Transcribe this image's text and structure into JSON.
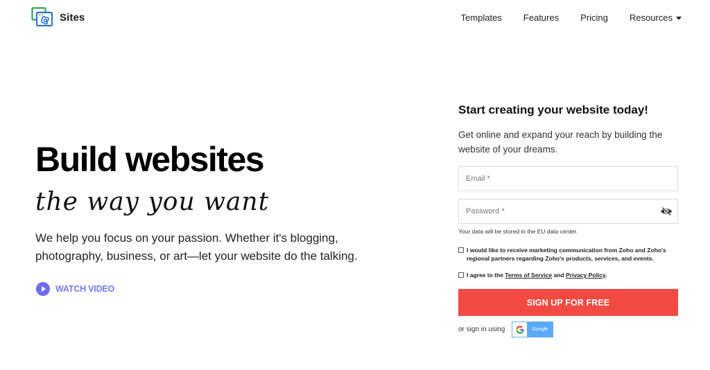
{
  "header": {
    "brand": "Sites",
    "logo_icon": "zoho-sites-icon",
    "nav": [
      {
        "label": "Templates"
      },
      {
        "label": "Features"
      },
      {
        "label": "Pricing"
      },
      {
        "label": "Resources",
        "has_dropdown": true
      }
    ]
  },
  "hero": {
    "title": "Build websites",
    "script_line": "the way you want",
    "description": "We help you focus on your passion. Whether it's blogging, photography, business, or art—let your website do the talking.",
    "watch_video": {
      "label": "WATCH VIDEO",
      "icon": "play-icon",
      "color": "#6f6cf2"
    }
  },
  "signup": {
    "title": "Start creating your website today!",
    "subtitle": "Get online and expand your reach by building the website of your dreams.",
    "email": {
      "placeholder": "Email *",
      "value": ""
    },
    "password": {
      "placeholder": "Password *",
      "value": "",
      "toggle_icon": "eye-slash-icon"
    },
    "data_note": "Your data will be stored in the EU data center.",
    "marketing_consent": {
      "label": "I would like to receive marketing communication from Zoho and Zoho's regional partners regarding Zoho's products, services, and events.",
      "checked": false
    },
    "terms_consent": {
      "prefix": "I agree to the ",
      "terms_link": "Terms of Service",
      "middle": " and ",
      "privacy_link": "Privacy Policy",
      "suffix": ".",
      "checked": false
    },
    "submit_label": "SIGN UP FOR FREE",
    "submit_color": "#f24a42",
    "social_label": "or sign in using",
    "google": {
      "letter": "G",
      "label": "Google",
      "color": "#5aaaf6"
    }
  }
}
